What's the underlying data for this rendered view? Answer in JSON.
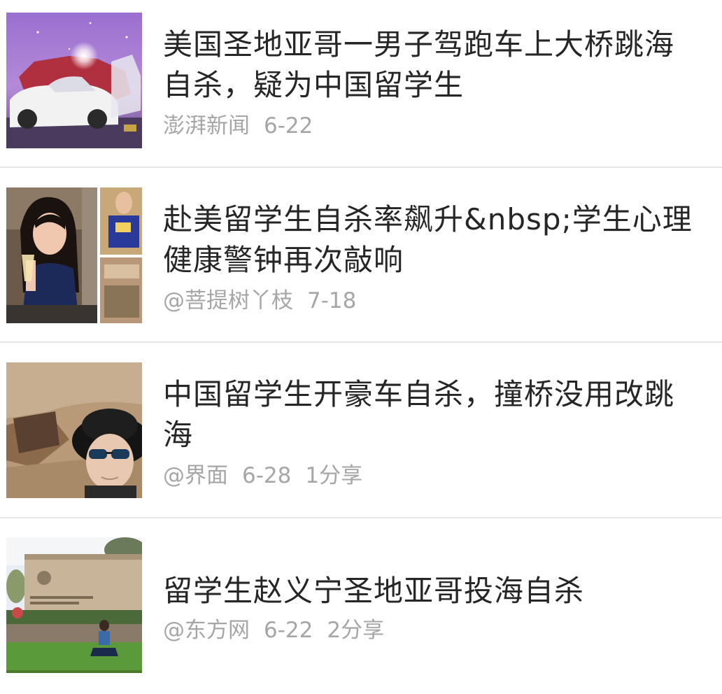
{
  "articles": [
    {
      "title": "美国圣地亚哥一男子驾跑车上大桥跳海自杀，疑为中国留学生",
      "source": "澎湃新闻",
      "date": "6-22",
      "shares": "",
      "thumbnail": "crashed-white-sports-car-photo"
    },
    {
      "title": "赴美留学生自杀率飙升&nbsp;学生心理健康警钟再次敲响",
      "source": "@菩提树丫枝",
      "date": "7-18",
      "shares": "",
      "thumbnail": "young-woman-collage-photo"
    },
    {
      "title": "中国留学生开豪车自杀，撞桥没用改跳海",
      "source": "@界面",
      "date": "6-28",
      "shares": "1分享",
      "thumbnail": "man-selfie-sunglasses-hat-photo"
    },
    {
      "title": "留学生赵义宁圣地亚哥投海自杀",
      "source": "@东方网",
      "date": "6-22",
      "shares": "2分享",
      "thumbnail": "university-sign-lawn-photo"
    }
  ]
}
